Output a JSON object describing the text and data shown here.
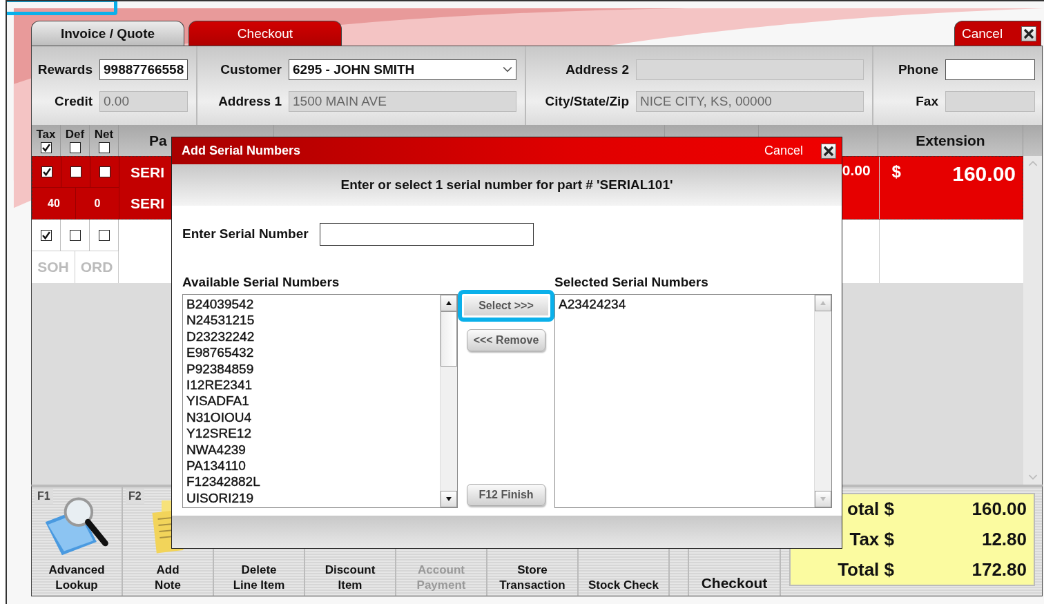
{
  "tabs": [
    {
      "label": "Invoice / Quote",
      "selected": true
    },
    {
      "label": "Checkout",
      "selected": false
    }
  ],
  "cancel_button": {
    "label": "Cancel"
  },
  "form": {
    "rewards": {
      "label": "Rewards",
      "value": "99887766558"
    },
    "credit": {
      "label": "Credit",
      "value": "0.00",
      "disabled": true
    },
    "customer": {
      "label": "Customer",
      "value": "6295 - JOHN SMITH"
    },
    "address_1": {
      "label": "Address 1",
      "value": "1500 MAIN AVE",
      "disabled": true
    },
    "address_2": {
      "label": "Address 2",
      "disabled": true
    },
    "city_state_zip": {
      "label": "City/State/Zip",
      "value": "NICE CITY, KS, 00000",
      "disabled": true
    },
    "phone": {
      "label": "Phone",
      "disabled": false
    },
    "fax": {
      "label": "Fax",
      "disabled": true
    }
  },
  "table": {
    "flag_columns": [
      {
        "label": "Tax",
        "checked": true
      },
      {
        "label": "Def",
        "checked": false
      },
      {
        "label": "Net",
        "checked": false
      }
    ],
    "part_column": "Pa",
    "extension_column": "Extension",
    "rows": [
      {
        "selected": true,
        "flags": [
          true,
          false,
          false
        ],
        "part": "SERI",
        "soh": "40",
        "ord": "0",
        "part_2": "SERI",
        "price": "0.00",
        "currency": "$",
        "extension": "160.00"
      },
      {
        "selected": false,
        "flags": [
          true,
          false,
          false
        ],
        "soh": "SOH",
        "ord": "ORD"
      }
    ]
  },
  "toolbar": [
    {
      "key": "F1",
      "lines": [
        "Advanced",
        "Lookup"
      ],
      "kind": "lookup",
      "disabled": false
    },
    {
      "key": "F2",
      "lines": [
        "Add",
        "Note"
      ],
      "kind": "note",
      "disabled": false
    },
    {
      "lines": [
        "Delete",
        "Line Item"
      ],
      "disabled": false
    },
    {
      "lines": [
        "Discount",
        "Item"
      ],
      "disabled": false
    },
    {
      "lines": [
        "Account",
        "Payment"
      ],
      "disabled": true
    },
    {
      "lines": [
        "Store",
        "Transaction"
      ],
      "disabled": false
    },
    {
      "lines": [
        "Stock Check"
      ],
      "disabled": false
    }
  ],
  "checkout_button": "Checkout",
  "totals": [
    {
      "label": "otal $",
      "value": "160.00"
    },
    {
      "label": "Tax $",
      "value": "12.80"
    },
    {
      "label": "Total $",
      "value": "172.80"
    }
  ],
  "dialog": {
    "title": "Add Serial Numbers",
    "cancel": "Cancel",
    "instruction": "Enter or select 1 serial number for part # 'SERIAL101'",
    "serial_field": {
      "label": "Enter Serial Number"
    },
    "available": {
      "label": "Available Serial Numbers",
      "items": [
        "B24039542",
        "N24531215",
        "D23232242",
        "E98765432",
        "P92384859",
        "I12RE2341",
        "YISADFA1",
        "N31OIOU4",
        "Y12SRE12",
        "NWA4239",
        "PA134110",
        "F12342882L",
        "UISORI219"
      ]
    },
    "selected": {
      "label": "Selected Serial Numbers",
      "items": [
        "A23424234"
      ]
    },
    "buttons": [
      {
        "label": "Select >>>",
        "highlighted": true
      },
      {
        "label": "<<< Remove",
        "highlighted": false
      },
      {
        "label": "F12  Finish",
        "highlighted": false
      }
    ]
  }
}
